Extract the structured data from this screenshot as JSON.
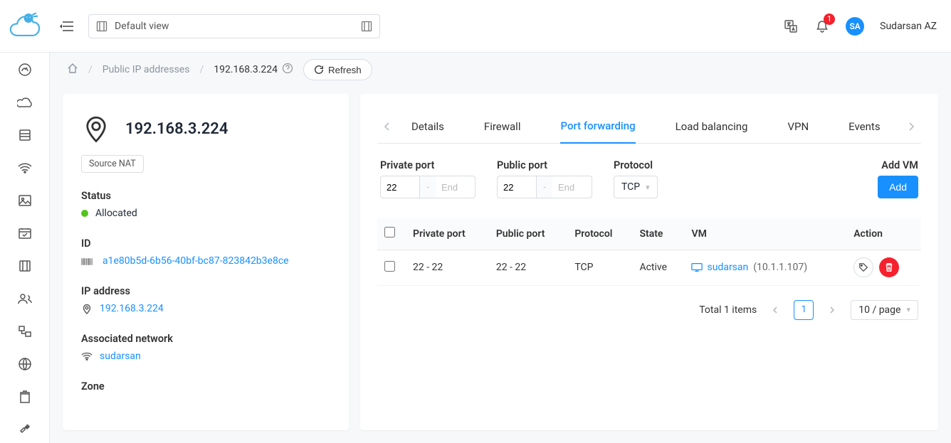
{
  "header": {
    "view_label": "Default view",
    "notification_count": "1",
    "user_initials": "SA",
    "user_name": "Sudarsan AZ"
  },
  "breadcrumb": {
    "level1": "Public IP addresses",
    "current": "192.168.3.224",
    "refresh_label": "Refresh"
  },
  "left_panel": {
    "ip_title": "192.168.3.224",
    "chip": "Source NAT",
    "status_label": "Status",
    "status_value": "Allocated",
    "id_label": "ID",
    "id_value": "a1e80b5d-6b56-40bf-bc87-823842b3e8ce",
    "ip_addr_label": "IP address",
    "ip_addr_value": "192.168.3.224",
    "net_label": "Associated network",
    "net_value": "sudarsan",
    "zone_label": "Zone"
  },
  "tabs": {
    "details": "Details",
    "firewall": "Firewall",
    "port_forwarding": "Port forwarding",
    "load_balancing": "Load balancing",
    "vpn": "VPN",
    "events": "Events"
  },
  "filters": {
    "private_port_label": "Private port",
    "public_port_label": "Public port",
    "protocol_label": "Protocol",
    "private_start": "22",
    "private_end_placeholder": "End",
    "public_start": "22",
    "public_end_placeholder": "End",
    "protocol_value": "TCP",
    "add_vm_label": "Add VM",
    "add_btn": "Add"
  },
  "table": {
    "cols": {
      "private": "Private port",
      "public": "Public port",
      "protocol": "Protocol",
      "state": "State",
      "vm": "VM",
      "action": "Action"
    },
    "rows": [
      {
        "private": "22 - 22",
        "public": "22 - 22",
        "protocol": "TCP",
        "state": "Active",
        "vm_name": "sudarsan",
        "vm_ip": "(10.1.1.107)"
      }
    ]
  },
  "pager": {
    "total_text": "Total 1 items",
    "page": "1",
    "size": "10 / page"
  }
}
